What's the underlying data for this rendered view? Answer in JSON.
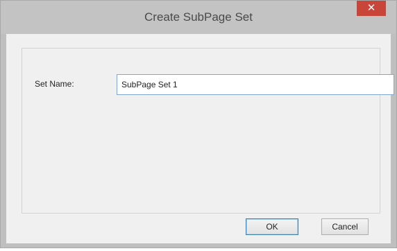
{
  "window": {
    "title": "Create SubPage Set",
    "close_glyph": "✕",
    "close_icon": "close-icon"
  },
  "form": {
    "set_name_label": "Set Name:",
    "set_name_value": "SubPage Set 1"
  },
  "buttons": {
    "ok_label": "OK",
    "cancel_label": "Cancel"
  },
  "colors": {
    "close_button": "#c9453a",
    "titlebar": "#c3c3c3",
    "input_border": "#7ea7d8"
  }
}
